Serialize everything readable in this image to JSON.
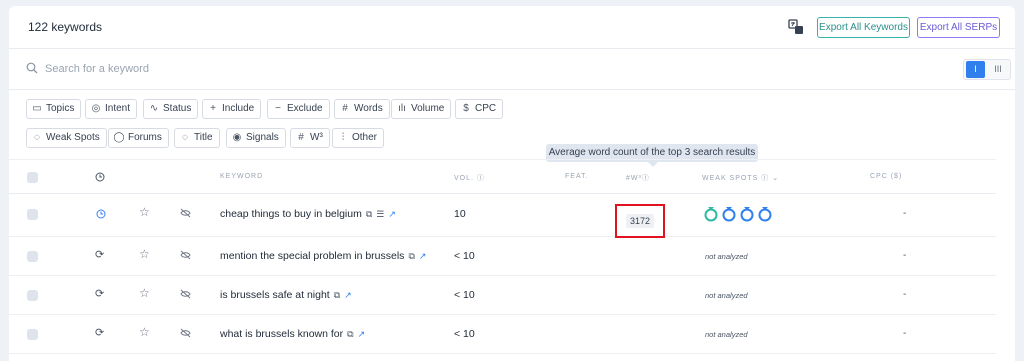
{
  "header": {
    "title": "122 keywords",
    "export_keywords": "Export All Keywords",
    "export_serps": "Export All SERPs"
  },
  "search": {
    "placeholder": "Search for a keyword"
  },
  "view_toggle": {
    "a": "I",
    "b": "III"
  },
  "filters": [
    {
      "icon": "map-icon",
      "glyph": "▭",
      "label": "Topics"
    },
    {
      "icon": "target-icon",
      "glyph": "◎",
      "label": "Intent"
    },
    {
      "icon": "pulse-icon",
      "glyph": "∿",
      "label": "Status"
    },
    {
      "icon": "plus-icon",
      "glyph": "+",
      "label": "Include"
    },
    {
      "icon": "minus-icon",
      "glyph": "−",
      "label": "Exclude"
    },
    {
      "icon": "hash-icon",
      "glyph": "#",
      "label": "Words"
    },
    {
      "icon": "bar-chart-icon",
      "glyph": "ılı",
      "label": "Volume"
    },
    {
      "icon": "dollar-icon",
      "glyph": "$",
      "label": "CPC"
    },
    {
      "icon": "weak-spot-icon",
      "glyph": "◌",
      "label": "Weak Spots"
    },
    {
      "icon": "chat-icon",
      "glyph": "◯",
      "label": "Forums"
    },
    {
      "icon": "title-icon",
      "glyph": "◌",
      "label": "Title"
    },
    {
      "icon": "signal-icon",
      "glyph": "◉",
      "label": "Signals"
    },
    {
      "icon": "hash-w3-icon",
      "glyph": "#",
      "label": "W³"
    },
    {
      "icon": "sliders-icon",
      "glyph": "⫶",
      "label": "Other"
    }
  ],
  "tooltip": "Average word count of the top 3 search results",
  "columns": {
    "keyword": "KEYWORD",
    "vol": "VOL.",
    "feat": "FEAT.",
    "w3": "#W³",
    "weak_spots": "WEAK SPOTS",
    "cpc": "CPC ($)"
  },
  "rows": [
    {
      "keyword": "cheap things to buy in belgium",
      "vol": "10",
      "w3": "3172",
      "weak": "",
      "cpc": "-"
    },
    {
      "keyword": "mention the special problem in brussels",
      "vol": "< 10",
      "w3": "",
      "weak": "not analyzed",
      "cpc": "-"
    },
    {
      "keyword": "is brussels safe at night",
      "vol": "< 10",
      "w3": "",
      "weak": "not analyzed",
      "cpc": "-"
    },
    {
      "keyword": "what is brussels known for",
      "vol": "< 10",
      "w3": "",
      "weak": "not analyzed",
      "cpc": "-"
    }
  ],
  "colors": {
    "accent": "#2f80ed",
    "teal": "#38b2ac",
    "purple": "#8b7cf6",
    "highlight": "#e0141e"
  }
}
